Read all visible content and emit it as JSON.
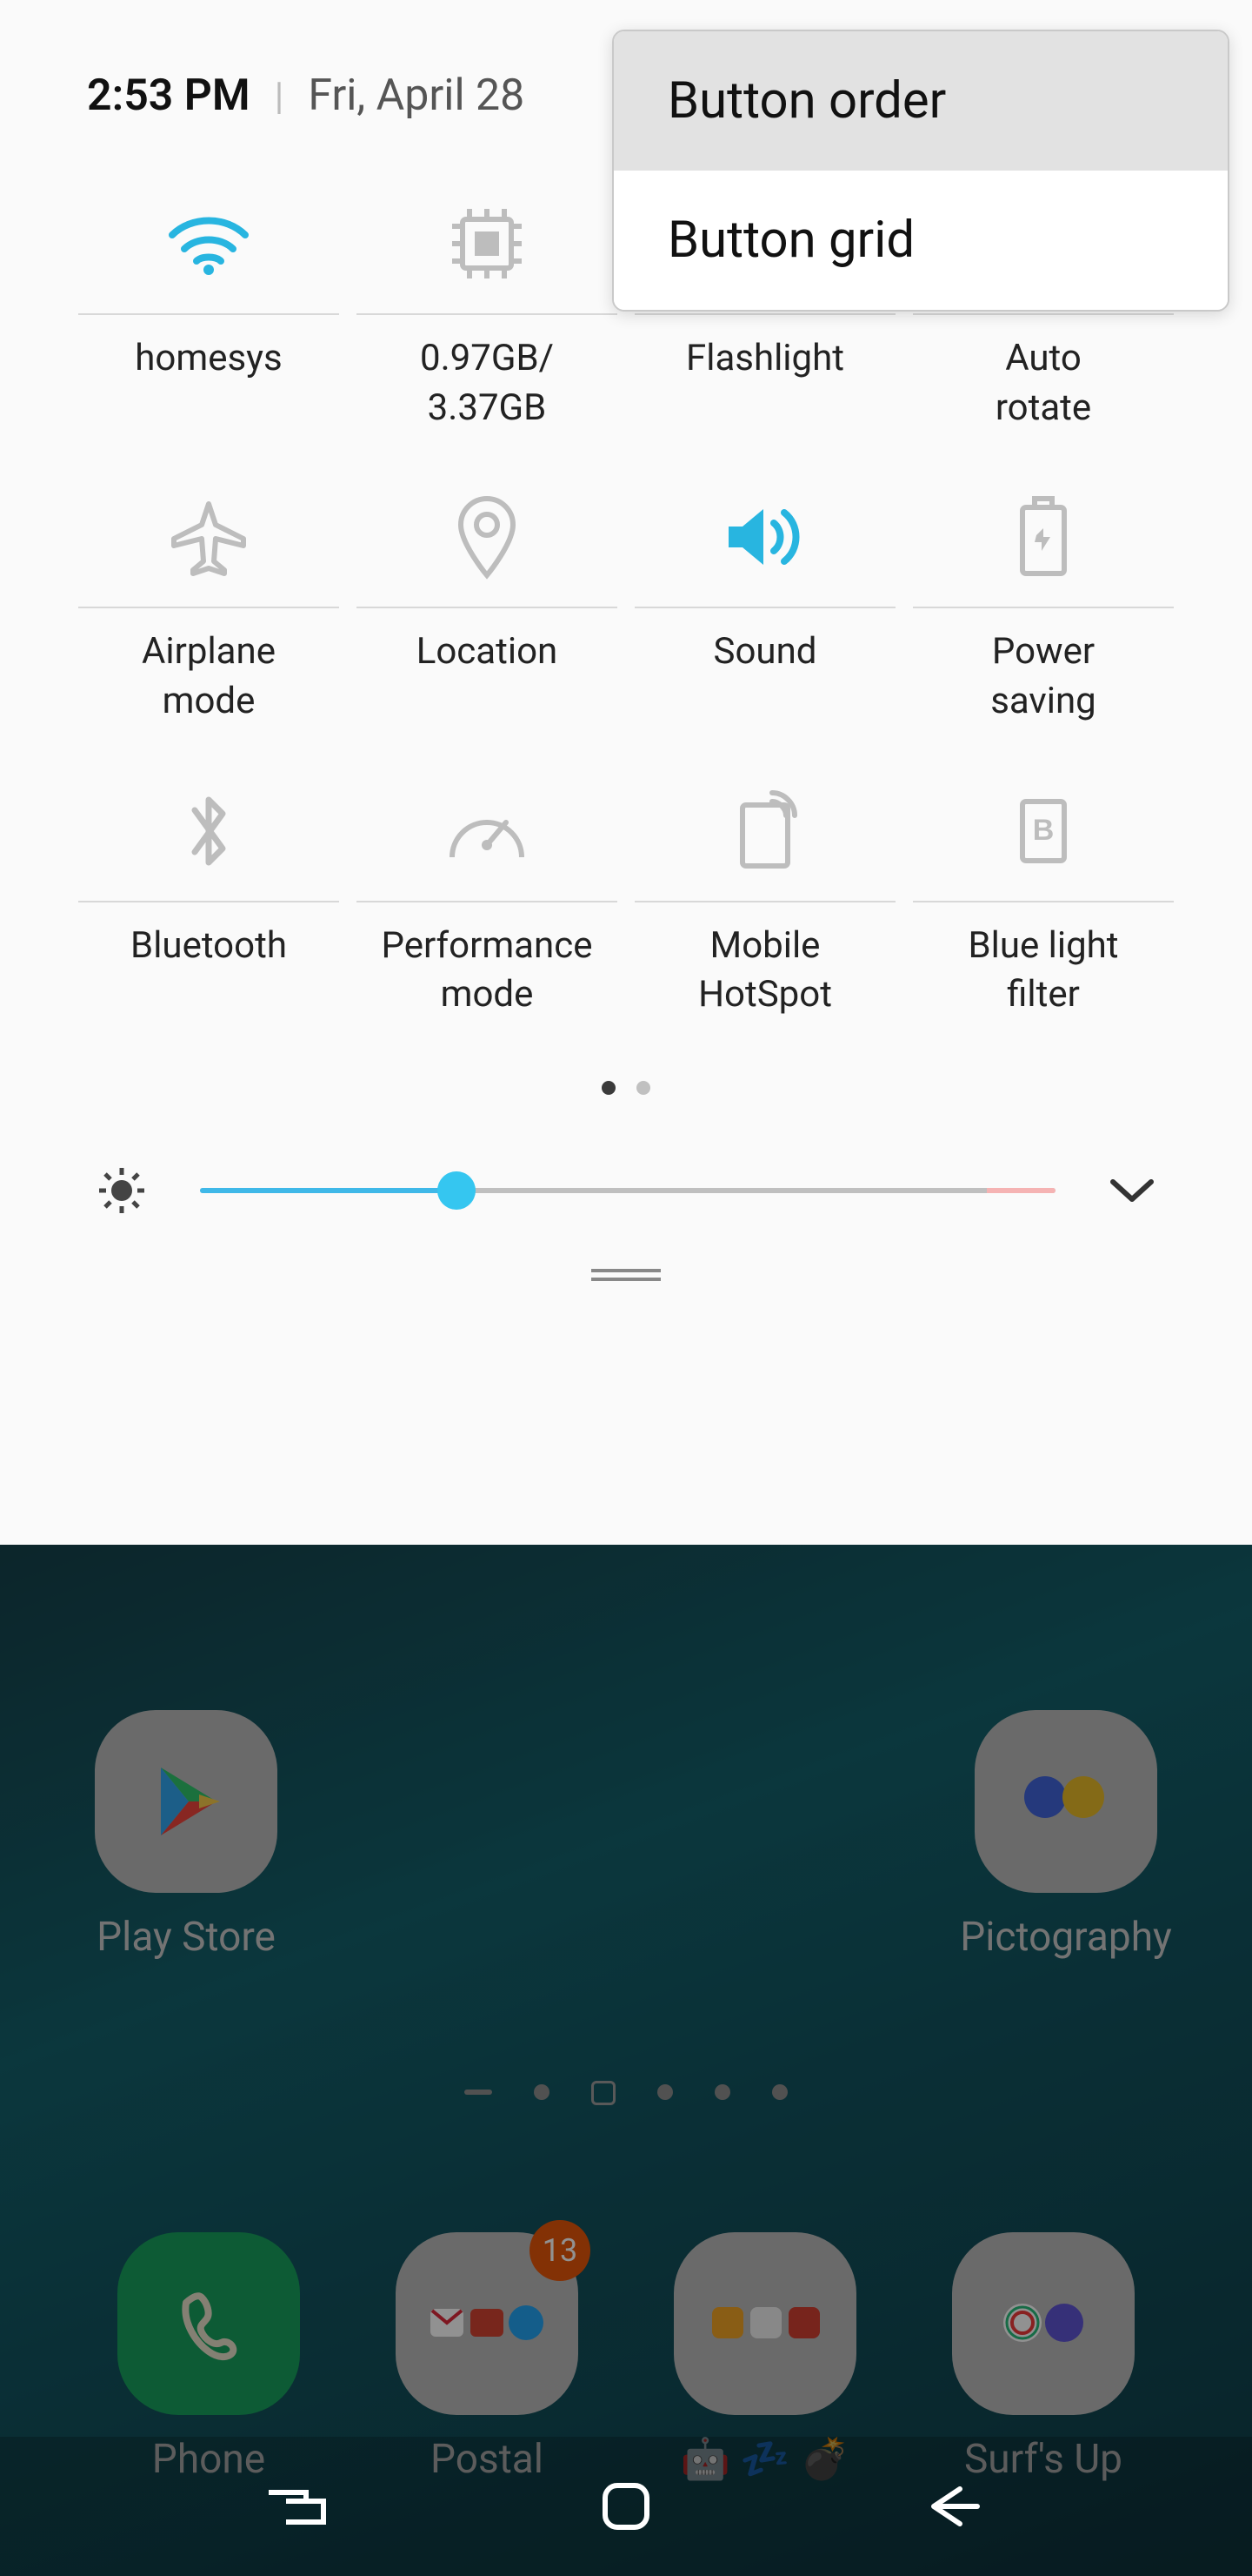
{
  "status": {
    "time": "2:53 PM",
    "date": "Fri, April 28"
  },
  "quick_tiles": [
    {
      "id": "wifi",
      "label": "homesys",
      "active": true
    },
    {
      "id": "ram",
      "label": "0.97GB/\n3.37GB",
      "active": false
    },
    {
      "id": "flashlight",
      "label": "Flashlight",
      "active": false
    },
    {
      "id": "autorotate",
      "label": "Auto\nrotate",
      "active": false
    },
    {
      "id": "airplane",
      "label": "Airplane\nmode",
      "active": false
    },
    {
      "id": "location",
      "label": "Location",
      "active": false
    },
    {
      "id": "sound",
      "label": "Sound",
      "active": true
    },
    {
      "id": "power",
      "label": "Power\nsaving",
      "active": false
    },
    {
      "id": "bluetooth",
      "label": "Bluetooth",
      "active": false
    },
    {
      "id": "performance",
      "label": "Performance\nmode",
      "active": false
    },
    {
      "id": "hotspot",
      "label": "Mobile\nHotSpot",
      "active": false
    },
    {
      "id": "bluelight",
      "label": "Blue light\nfilter",
      "active": false
    }
  ],
  "brightness_percent": 30,
  "popup_menu": {
    "items": [
      "Button order",
      "Button grid"
    ],
    "highlighted_index": 0
  },
  "colors": {
    "accent": "#35c6f0",
    "inactive": "#b9b9b9",
    "text": "#222222"
  },
  "home_screen": {
    "row1": [
      {
        "id": "playstore",
        "label": "Play Store"
      },
      {
        "id": "pictography",
        "label": "Pictography"
      }
    ],
    "row2": [
      {
        "id": "phone",
        "label": "Phone"
      },
      {
        "id": "postal",
        "label": "Postal",
        "badge": "13"
      },
      {
        "id": "folder3",
        "label": "🤖 💤 💣"
      },
      {
        "id": "surfs",
        "label": "Surf's Up"
      }
    ]
  }
}
